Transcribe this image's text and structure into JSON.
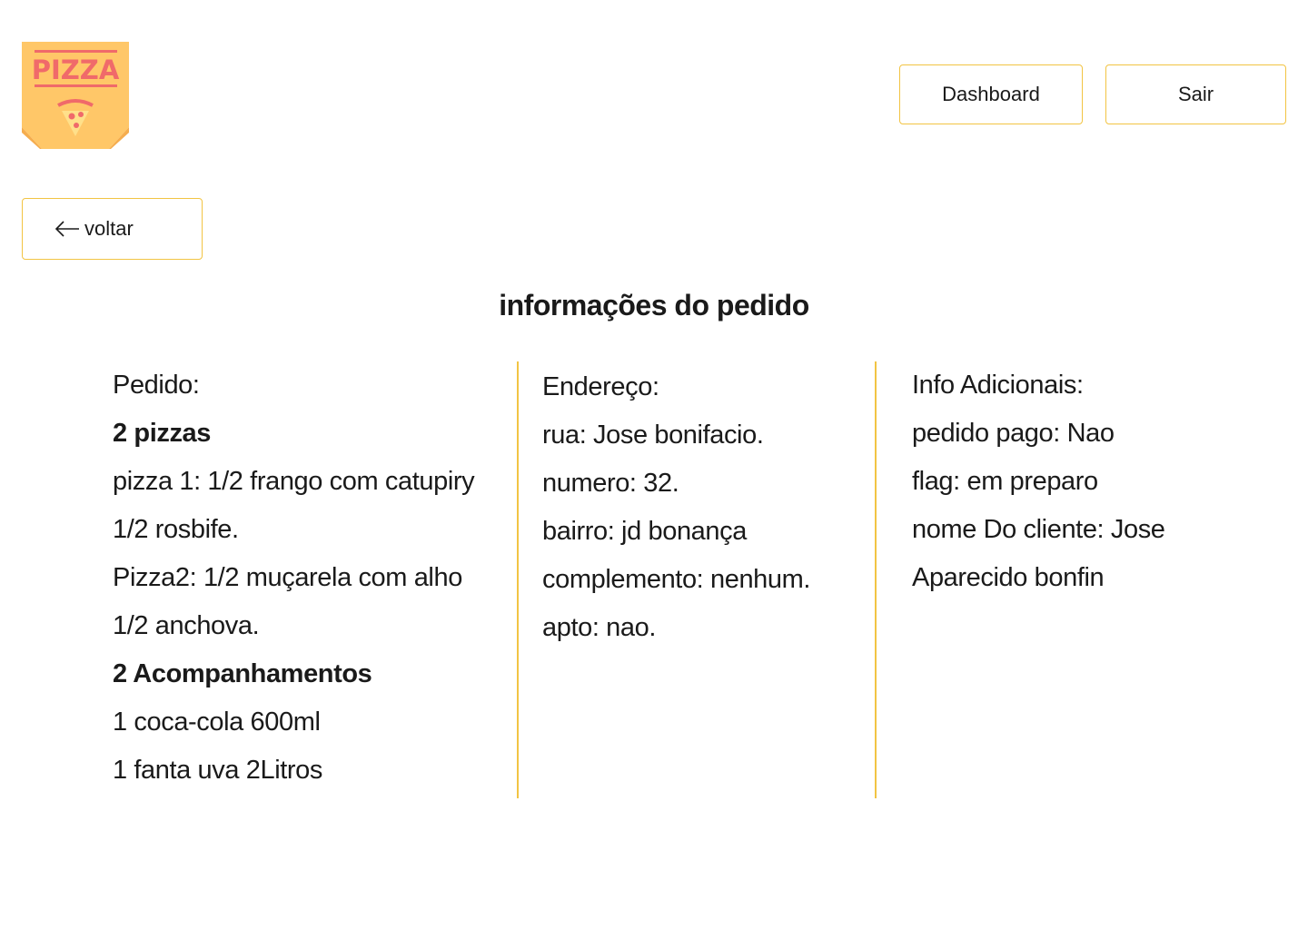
{
  "logo": {
    "text": "PIZZA",
    "icon": "pizza-logo-icon",
    "colors": {
      "background": "#ffc768",
      "accent": "#f06a6a"
    }
  },
  "header": {
    "dashboard_label": "Dashboard",
    "logout_label": "Sair"
  },
  "back": {
    "label": "voltar",
    "icon": "arrow-left-icon"
  },
  "page": {
    "title": "informações do pedido"
  },
  "order": {
    "heading": "Pedido:",
    "pizzas_title": "2 pizzas",
    "pizza_lines": [
      "pizza 1: 1/2 frango com catupiry",
      "1/2 rosbife.",
      "Pizza2: 1/2 muçarela com alho",
      "1/2 anchova."
    ],
    "sides_title": "2 Acompanhamentos",
    "side_lines": [
      "1 coca-cola 600ml",
      "1 fanta uva 2Litros"
    ]
  },
  "address": {
    "heading": "Endereço:",
    "lines": [
      "rua: Jose bonifacio.",
      "numero: 32.",
      "bairro: jd bonança",
      "complemento: nenhum.",
      "apto: nao."
    ]
  },
  "extra": {
    "heading": "Info Adicionais:",
    "lines": [
      "pedido pago: Nao",
      "flag: em preparo",
      "nome Do cliente: Jose",
      "Aparecido bonfin"
    ]
  },
  "theme": {
    "accent": "#f2c443"
  }
}
